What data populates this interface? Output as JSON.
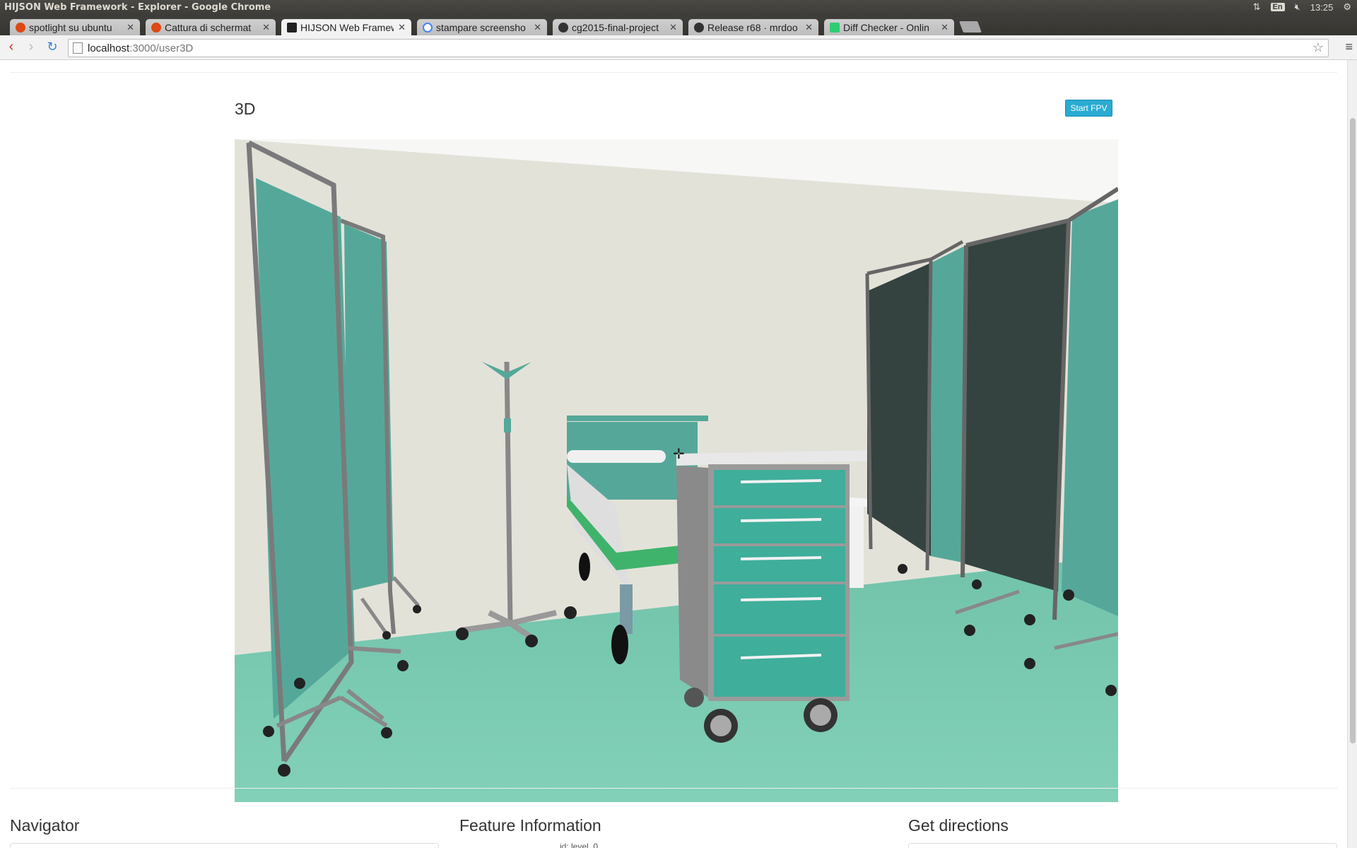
{
  "os": {
    "window_title": "HIJSON Web Framework - Explorer - Google Chrome",
    "keyboard": "En",
    "clock": "13:25"
  },
  "tabs": [
    {
      "label": "spotlight su ubuntu",
      "icon": "ubuntu-icon",
      "color": "#dd4814"
    },
    {
      "label": "Cattura di schermat",
      "icon": "ubuntu-icon",
      "color": "#dd4814"
    },
    {
      "label": "HIJSON Web Framew",
      "icon": "terminal-icon",
      "color": "#222222"
    },
    {
      "label": "stampare screensho",
      "icon": "google-icon",
      "color": "#4285f4"
    },
    {
      "label": "cg2015-final-project",
      "icon": "github-icon",
      "color": "#333333"
    },
    {
      "label": "Release r68 · mrdoo",
      "icon": "github-icon",
      "color": "#333333"
    },
    {
      "label": "Diff Checker - Onlin",
      "icon": "diffchecker-icon",
      "color": "#2ecc71"
    }
  ],
  "address": {
    "host": "localhost",
    "path": ":3000/user3D"
  },
  "page": {
    "title": "3D",
    "start_fpv": "Start FPV"
  },
  "sections": {
    "navigator": "Navigator",
    "feature_info": "Feature Information",
    "directions": "Get directions",
    "feature_partial": "id:   level_0"
  },
  "scene_colors": {
    "wall": "#e3e2d9",
    "floor": "#80cdb4",
    "curtain": "#55a899",
    "curtain_dark": "#34433f",
    "cart": "#3fae9b",
    "frame": "#7a7a7a"
  }
}
